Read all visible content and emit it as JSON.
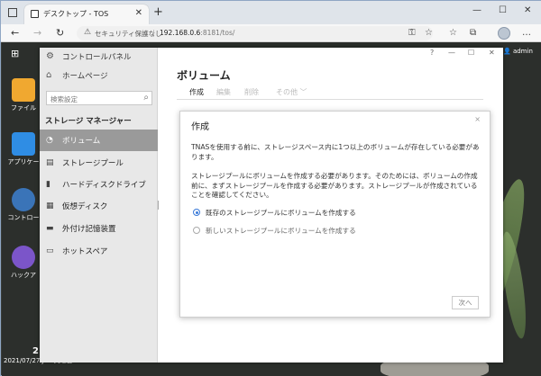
{
  "browser": {
    "tab_title": "デスクトップ - TOS",
    "tab_close": "✕",
    "new_tab": "+",
    "security_label": "セキュリティ保護なし",
    "url_host": "192.168.0.6",
    "url_path": ":8181/tos/",
    "window_controls": [
      "—",
      "☐",
      "✕"
    ]
  },
  "desktop": {
    "icons": [
      {
        "label": "ファイル",
        "color": "#f0a830"
      },
      {
        "label": "アプリケー",
        "color": "#2f8de4"
      },
      {
        "label": "コントロー",
        "color": "#3a74b8"
      },
      {
        "label": "ハックア",
        "color": "#7b55c9"
      }
    ],
    "user": "admin",
    "clock_time": "2",
    "clock_date": "2021/07/27 JST 火曜日"
  },
  "app": {
    "title_buttons": [
      "?",
      "—",
      "☐",
      "✕"
    ],
    "sidebar": {
      "control_panel": "コントロールパネル",
      "home": "ホームページ",
      "search_placeholder": "検索設定",
      "section": "ストレージ マネージャー",
      "items": [
        {
          "label": "ボリューム",
          "icon": "pie-icon",
          "glyph": "◔",
          "active": true
        },
        {
          "label": "ストレージプール",
          "icon": "storage-pool-icon",
          "glyph": "▤",
          "active": false
        },
        {
          "label": "ハードディスクドライブ",
          "icon": "hdd-icon",
          "glyph": "▮",
          "active": false
        },
        {
          "label": "仮想ディスク",
          "icon": "virtual-disk-icon",
          "glyph": "▦",
          "active": false
        },
        {
          "label": "外付け記憶装置",
          "icon": "external-storage-icon",
          "glyph": "▬",
          "active": false
        },
        {
          "label": "ホットスペア",
          "icon": "hot-spare-icon",
          "glyph": "▭",
          "active": false
        }
      ]
    },
    "main": {
      "title": "ボリューム",
      "toolbar": {
        "create": "作成",
        "edit": "編集",
        "delete": "削除",
        "other": "その他 ﹀"
      }
    }
  },
  "modal": {
    "title": "作成",
    "close": "×",
    "paragraph1": "TNASを使用する前に、ストレージスペース内に1つ以上のボリュームが存在している必要があります。",
    "paragraph2": "ストレージプールにボリュームを作成する必要があります。そのためには、ボリュームの作成前に、まずストレージプールを作成する必要があります。ストレージプールが作成されていることを確認してください。",
    "option1": "既存のストレージプールにボリュームを作成する",
    "option2": "新しいストレージプールにボリュームを作成する",
    "next": "次へ"
  }
}
